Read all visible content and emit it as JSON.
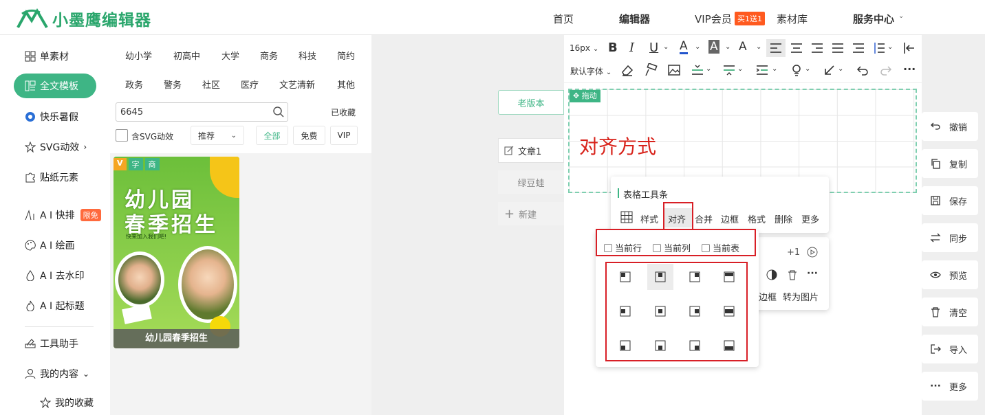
{
  "brand": {
    "name": "小墨鹰编辑器"
  },
  "nav": {
    "home": "首页",
    "editor": "编辑器",
    "vip": "VIP会员",
    "vip_badge": "买1送1",
    "library": "素材库",
    "service": "服务中心"
  },
  "sidebar": {
    "single": "单素材",
    "full": "全文模板",
    "summer": "快乐暑假",
    "svg": "SVG动效",
    "sticker": "贴纸元素",
    "ai_layout": "A I 快排",
    "ai_badge": "限免",
    "ai_paint": "A I 绘画",
    "ai_watermark": "A I 去水印",
    "ai_title": "A I 起标题",
    "tools": "工具助手",
    "mine": "我的内容",
    "fav": "我的收藏"
  },
  "categories": [
    "幼小学",
    "初高中",
    "大学",
    "商务",
    "科技",
    "简约",
    "政务",
    "警务",
    "社区",
    "医疗",
    "文艺清新",
    "其他"
  ],
  "search": {
    "value": "6645",
    "collected": "已收藏"
  },
  "filters": {
    "svg": "含SVG动效",
    "sort": "推荐",
    "all": "全部",
    "free": "免费",
    "vip": "VIP"
  },
  "card": {
    "tags": [
      "V",
      "字",
      "商"
    ],
    "line1": "幼儿园",
    "line2": "春季招生",
    "sub": "快来加入我们吧!",
    "caption": "幼儿园春季招生"
  },
  "middle": {
    "old": "老版本",
    "article": "文章1",
    "beans": "绿豆蛙",
    "new": "新建"
  },
  "toolbar": {
    "size": "16px",
    "font": "默认字体"
  },
  "canvas": {
    "drag": "拖动",
    "title": "对齐方式"
  },
  "table_toolbar": {
    "title": "表格工具条",
    "items": [
      "样式",
      "对齐",
      "合并",
      "边框",
      "格式",
      "删除",
      "更多"
    ]
  },
  "align_scope": [
    "当前行",
    "当前列",
    "当前表"
  ],
  "behind_popup": {
    "plus": "+1",
    "border": "边框",
    "to_image": "转为图片"
  },
  "rail": [
    "撤销",
    "复制",
    "保存",
    "同步",
    "预览",
    "清空",
    "导入",
    "更多"
  ],
  "colors": {
    "brand": "#2aa66c",
    "accent": "#3eb585",
    "highlight": "#d81f26"
  }
}
